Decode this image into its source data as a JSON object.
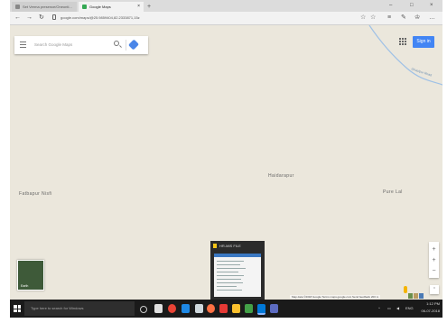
{
  "browser": {
    "tabs": [
      {
        "label": "Set Verma presence/Oneonti..."
      },
      {
        "label": "Google Maps",
        "close": "×"
      }
    ],
    "new_tab": "+",
    "window_controls": [
      "–",
      "□",
      "×"
    ],
    "nav": {
      "back": "←",
      "forward": "→",
      "refresh": "↻"
    },
    "url": "google.com/maps/@25.9859404,82.2333871,15z",
    "toolbar_icons": [
      "☆",
      "☆",
      "≡",
      "✎",
      "♔",
      "…"
    ]
  },
  "maps": {
    "search_placeholder": "Search Google Maps",
    "sign_in_label": "Sign in",
    "places": [
      {
        "label": "Haidarapur"
      },
      {
        "label": "Fatbapur Nisfi"
      },
      {
        "label": "Pure Lal"
      }
    ],
    "road_label": "Ghazipur Road",
    "earth_label": "Earth",
    "zoom_in": "+",
    "zoom_out": "−",
    "compass": "⌃",
    "footer": "Map data ©2018 Google   Terms   maps.google.com   Send feedback   200 m"
  },
  "task_preview": {
    "title": "HR-MIS FILE"
  },
  "taskbar": {
    "search_placeholder": "Type here to search for Windows",
    "tray_time": "1:12 PM",
    "tray_date": "06-07-2018",
    "tray_lang": "ENG",
    "tray_caret": "^"
  },
  "colors": {
    "map_bg": "#ebe7dc",
    "accent": "#4285f4",
    "taskbar": "#1a1a1a"
  }
}
